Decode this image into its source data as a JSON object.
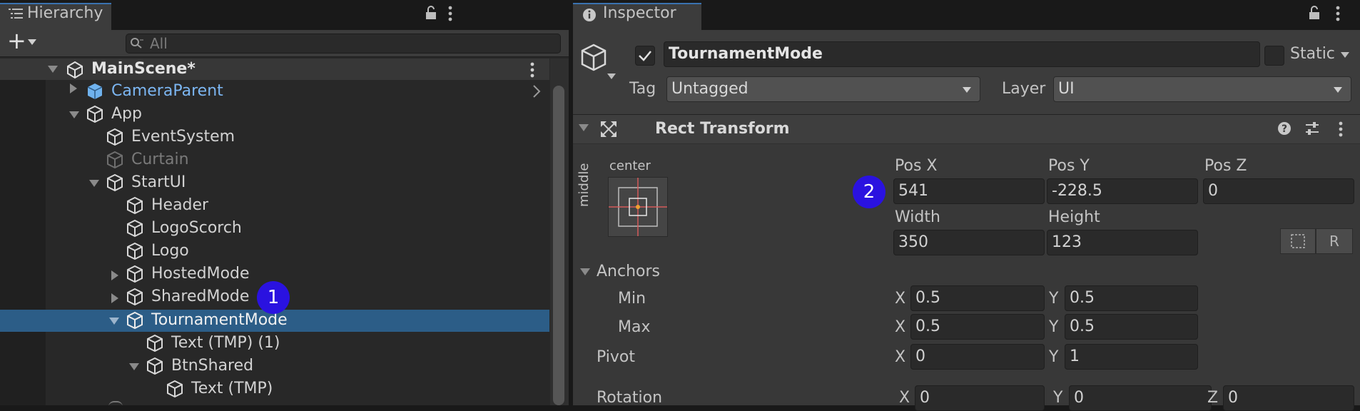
{
  "hierarchy": {
    "tab_label": "Hierarchy",
    "add_label": "+",
    "search_placeholder": "All",
    "scene_name": "MainScene*",
    "items": [
      {
        "label": "CameraParent"
      },
      {
        "label": "App"
      },
      {
        "label": "EventSystem"
      },
      {
        "label": "Curtain"
      },
      {
        "label": "StartUI"
      },
      {
        "label": "Header"
      },
      {
        "label": "LogoScorch"
      },
      {
        "label": "Logo"
      },
      {
        "label": "HostedMode"
      },
      {
        "label": "SharedMode"
      },
      {
        "label": "TournamentMode"
      },
      {
        "label": "Text (TMP) (1)"
      },
      {
        "label": "BtnShared"
      },
      {
        "label": "Text (TMP)"
      }
    ]
  },
  "badges": {
    "one": "1",
    "two": "2"
  },
  "inspector": {
    "tab_label": "Inspector",
    "object_name": "TournamentMode",
    "active_checked": true,
    "static_label": "Static",
    "tag_label": "Tag",
    "tag_value": "Untagged",
    "layer_label": "Layer",
    "layer_value": "UI",
    "component_title": "Rect Transform",
    "anchor_horizontal": "center",
    "anchor_vertical": "middle",
    "pos_x_label": "Pos X",
    "pos_y_label": "Pos Y",
    "pos_z_label": "Pos Z",
    "pos_x": "541",
    "pos_y": "-228.5",
    "pos_z": "0",
    "width_label": "Width",
    "height_label": "Height",
    "width": "350",
    "height": "123",
    "raw_button_label": "R",
    "anchors_label": "Anchors",
    "min_label": "Min",
    "max_label": "Max",
    "x_label": "X",
    "y_label": "Y",
    "z_label": "Z",
    "anchor_min_x": "0.5",
    "anchor_min_y": "0.5",
    "anchor_max_x": "0.5",
    "anchor_max_y": "0.5",
    "pivot_label": "Pivot",
    "pivot_x": "0",
    "pivot_y": "1",
    "rotation_label": "Rotation",
    "rotation_x": "0",
    "rotation_y": "0",
    "rotation_z": "0"
  },
  "colors": {
    "selection": "#2c5d87",
    "badge": "#2a12e0",
    "prefab_blue": "#7cb6f2",
    "disabled_text": "#7a7a7a"
  },
  "icons": [
    "list-icon",
    "lock-icon",
    "kebab-icon",
    "search-icon",
    "unity-scene-icon",
    "gameobject-icon",
    "prefab-icon",
    "info-icon",
    "move-arrows-icon",
    "help-icon",
    "preset-icon"
  ]
}
